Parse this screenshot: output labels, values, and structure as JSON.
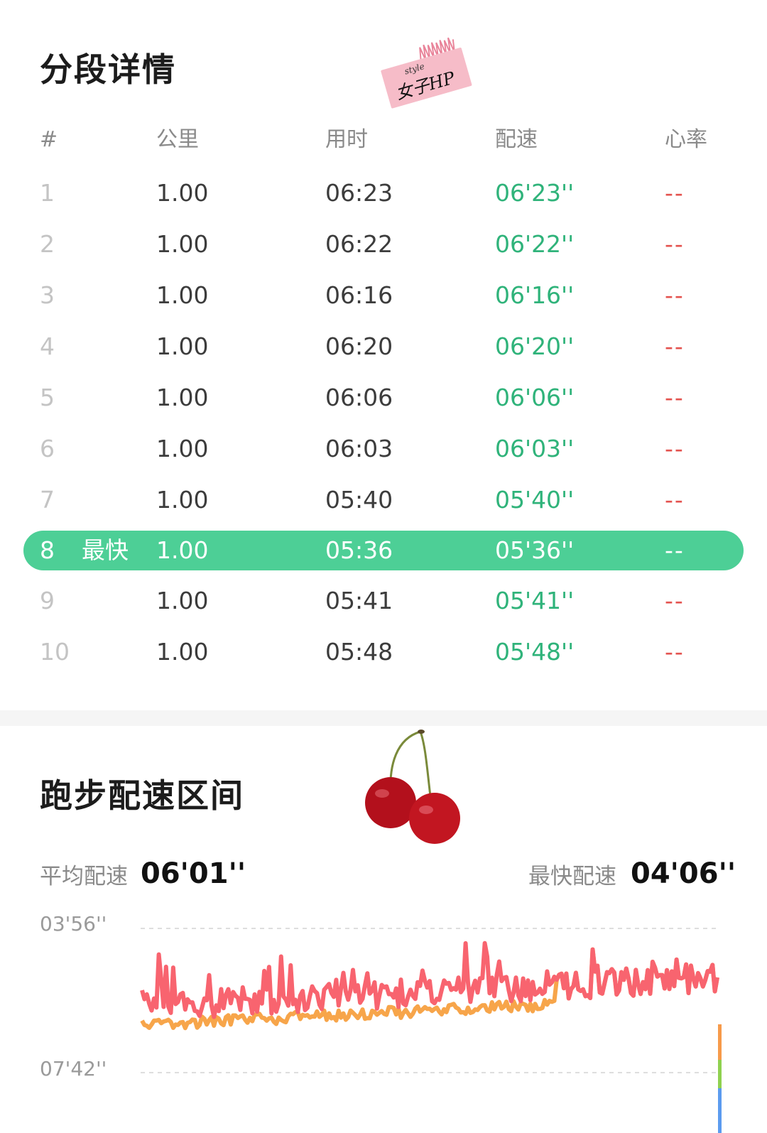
{
  "splits": {
    "title": "分段详情",
    "sticker": {
      "small_text": "style",
      "big_text": "女子HP"
    },
    "headers": [
      "#",
      "公里",
      "用时",
      "配速",
      "心率"
    ],
    "rows": [
      {
        "idx": "1",
        "km": "1.00",
        "time": "06:23",
        "pace": "06'23''",
        "hr": "--"
      },
      {
        "idx": "2",
        "km": "1.00",
        "time": "06:22",
        "pace": "06'22''",
        "hr": "--"
      },
      {
        "idx": "3",
        "km": "1.00",
        "time": "06:16",
        "pace": "06'16''",
        "hr": "--"
      },
      {
        "idx": "4",
        "km": "1.00",
        "time": "06:20",
        "pace": "06'20''",
        "hr": "--"
      },
      {
        "idx": "5",
        "km": "1.00",
        "time": "06:06",
        "pace": "06'06''",
        "hr": "--"
      },
      {
        "idx": "6",
        "km": "1.00",
        "time": "06:03",
        "pace": "06'03''",
        "hr": "--"
      },
      {
        "idx": "7",
        "km": "1.00",
        "time": "05:40",
        "pace": "05'40''",
        "hr": "--"
      },
      {
        "idx": "8",
        "tag": "最快",
        "km": "1.00",
        "time": "05:36",
        "pace": "05'36''",
        "hr": "--",
        "fastest": true
      },
      {
        "idx": "9",
        "km": "1.00",
        "time": "05:41",
        "pace": "05'41''",
        "hr": "--"
      },
      {
        "idx": "10",
        "km": "1.00",
        "time": "05:48",
        "pace": "05'48''",
        "hr": "--"
      }
    ]
  },
  "pace_zone": {
    "title": "跑步配速区间",
    "avg_label": "平均配速",
    "avg_value": "06'01''",
    "fastest_label": "最快配速",
    "fastest_value": "04'06''",
    "y_top_label": "03'56''",
    "y_bottom_label": "07'42''",
    "decoration": "cherry-icon"
  },
  "colors": {
    "pace_green": "#2fb37a",
    "highlight": "#4dcf96",
    "heart_rate_red": "#e4534f",
    "chart_red": "#f8646f",
    "chart_orange": "#f7a54a"
  }
}
